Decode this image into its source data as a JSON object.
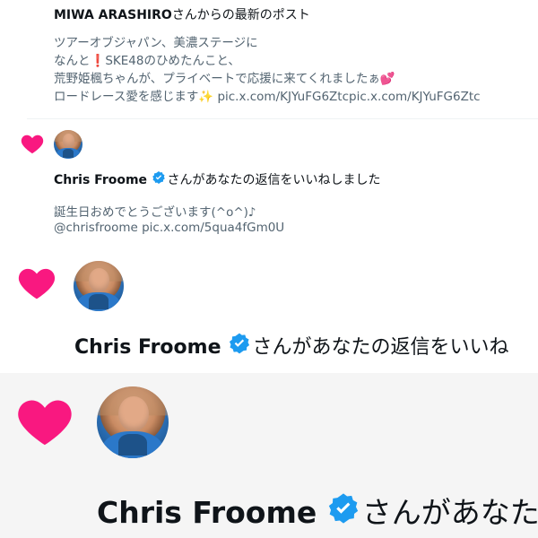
{
  "post1": {
    "header_bold": "MIWA ARASHIRO",
    "header_rest": "さんからの最新のポスト",
    "line1": "ツアーオブジャパン、美濃ステージに",
    "line2_a": "なんと",
    "line2_b": "SKE48のひめたんこと、",
    "line3": "荒野姫楓ちゃんが、プライベートで応援に来てくれましたぁ",
    "line4_a": "ロードレース愛を感じます",
    "line4_b": "pic.x.com/KJYuFG6Ztcpic.x.com/KJYuFG6Ztc"
  },
  "notif1": {
    "name": "Chris Froome",
    "action": "さんがあなたの返信をいいねしました",
    "text": "誕生日おめでとうございます(^o^)♪",
    "link": "@chrisfroome pic.x.com/5qua4fGm0U"
  },
  "notif2": {
    "name": "Chris Froome",
    "action": "さんがあなたの返信をいいね"
  },
  "notif3": {
    "name": "Chris Froome",
    "action": "さんがあなた"
  },
  "colors": {
    "heart": "#f91880",
    "verified": "#1d9bf0",
    "text": "#0f1419",
    "muted": "#536471",
    "zoom_bg": "#f5f5f5"
  },
  "icons": [
    "heart-icon",
    "verified-badge-icon",
    "exclamation-icon",
    "two-hearts-icon",
    "sparkles-icon"
  ]
}
